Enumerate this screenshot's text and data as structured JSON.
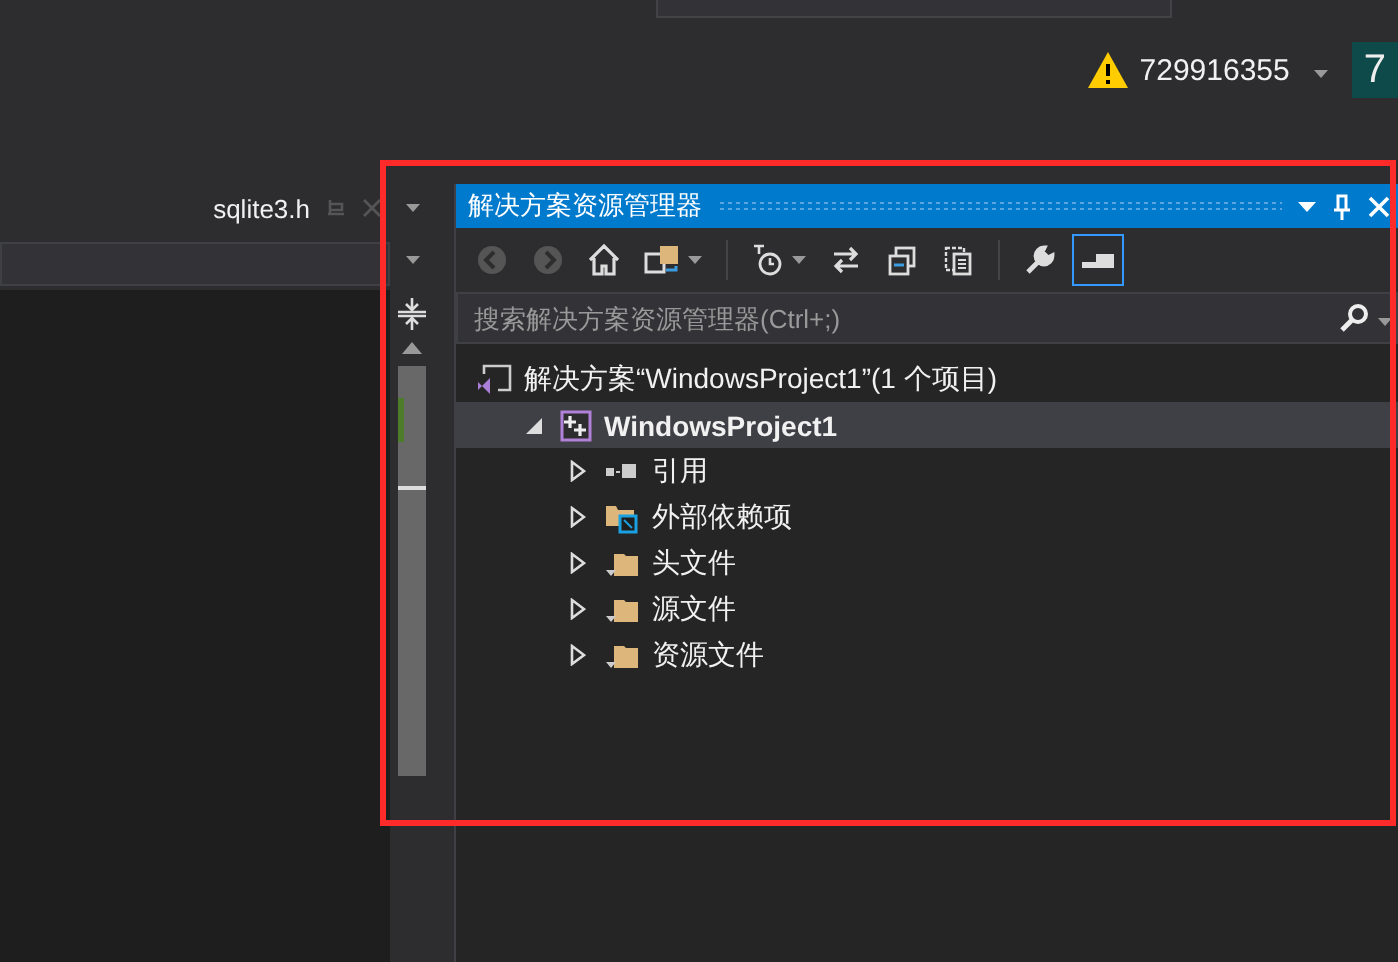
{
  "account": {
    "name": "729916355",
    "badge": "7"
  },
  "document_tabs": [
    {
      "label": "sqlite3.h",
      "selected": false
    }
  ],
  "solution_explorer": {
    "title": "解决方案资源管理器",
    "toolbar": [
      {
        "kind": "back",
        "disabled": true,
        "dropdown": false,
        "selected": false
      },
      {
        "kind": "forward",
        "disabled": true,
        "dropdown": false,
        "selected": false
      },
      {
        "kind": "home",
        "disabled": false,
        "dropdown": false,
        "selected": false
      },
      {
        "kind": "switch-views",
        "disabled": false,
        "dropdown": true,
        "selected": false
      },
      {
        "kind": "separator"
      },
      {
        "kind": "pending-filter",
        "disabled": false,
        "dropdown": true,
        "selected": false
      },
      {
        "kind": "sync",
        "disabled": false,
        "dropdown": false,
        "selected": false
      },
      {
        "kind": "collapse",
        "disabled": false,
        "dropdown": false,
        "selected": false
      },
      {
        "kind": "show-all",
        "disabled": false,
        "dropdown": false,
        "selected": false
      },
      {
        "kind": "separator"
      },
      {
        "kind": "properties",
        "disabled": false,
        "dropdown": false,
        "selected": false
      },
      {
        "kind": "preview",
        "disabled": false,
        "dropdown": false,
        "selected": true
      }
    ],
    "search": {
      "placeholder": "搜索解决方案资源管理器(Ctrl+;)"
    },
    "tree": [
      {
        "kind": "solution",
        "label": "解决方案“WindowsProject1”(1 个项目)",
        "selected": false,
        "children": [
          {
            "kind": "project",
            "label": "WindowsProject1",
            "expanded": true,
            "selected": true,
            "children": [
              {
                "kind": "references",
                "label": "引用",
                "expanded": false,
                "selected": false
              },
              {
                "kind": "external",
                "label": "外部依赖项",
                "expanded": false,
                "selected": false
              },
              {
                "kind": "filter",
                "label": "头文件",
                "expanded": false,
                "selected": false
              },
              {
                "kind": "filter",
                "label": "源文件",
                "expanded": false,
                "selected": false
              },
              {
                "kind": "filter",
                "label": "资源文件",
                "expanded": false,
                "selected": false
              }
            ]
          }
        ]
      }
    ]
  }
}
